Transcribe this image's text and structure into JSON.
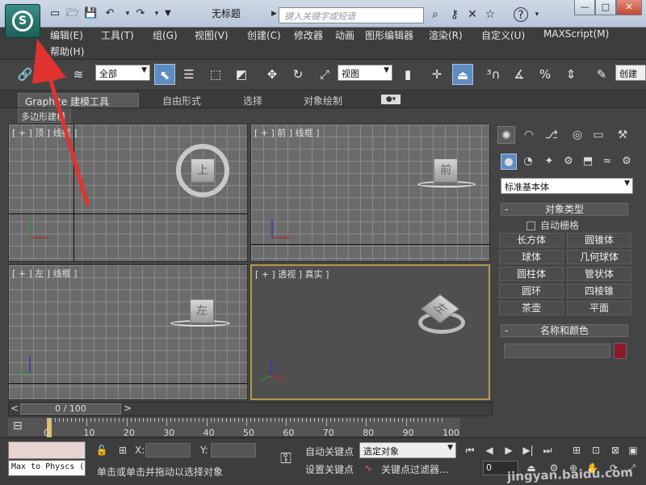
{
  "window": {
    "title": "无标题",
    "search_placeholder": "键入关键字或短语",
    "minimize": "—",
    "maximize": "□",
    "close": "✕"
  },
  "app_button": {
    "label": "S"
  },
  "menu": [
    {
      "label": "编辑(E)"
    },
    {
      "label": "工具(T)"
    },
    {
      "label": "组(G)"
    },
    {
      "label": "视图(V)"
    },
    {
      "label": "创建(C)"
    },
    {
      "label": "修改器"
    },
    {
      "label": "动画"
    },
    {
      "label": "图形编辑器"
    },
    {
      "label": "渲染(R)"
    },
    {
      "label": "自定义(U)"
    },
    {
      "label": "MAXScript(M)"
    },
    {
      "label": "帮助(H)"
    }
  ],
  "toolbar": {
    "selection_filter": "全部",
    "reference_coord": "视图",
    "named_selection": "创建"
  },
  "ribbon": {
    "tabs": [
      {
        "label": "Graphite 建模工具"
      },
      {
        "label": "自由形式"
      },
      {
        "label": "选择"
      },
      {
        "label": "对象绘制"
      }
    ],
    "subpanel": "多边形建模"
  },
  "viewports": {
    "top": {
      "label": "[ + ] 顶 ] 线框 ]",
      "cube": "上"
    },
    "front": {
      "label": "[ + ] 前 ] 线框 ]",
      "cube": "前"
    },
    "left": {
      "label": "[ + ] 左 ] 线框 ]",
      "cube": "左"
    },
    "perspective": {
      "label": "[ + ] 透视 ] 真实 ]",
      "cube": "左"
    }
  },
  "command_panel": {
    "category": "标准基本体",
    "object_type_header": "对象类型",
    "autogrid": "自动栅格",
    "objects": [
      "长方体",
      "圆锥体",
      "球体",
      "几何球体",
      "圆柱体",
      "管状体",
      "圆环",
      "四棱锥",
      "茶壶",
      "平面"
    ],
    "name_color_header": "名称和颜色",
    "object_color": "#8a1a2a"
  },
  "timeline": {
    "frame_display": "0 / 100",
    "prev": "<",
    "next": ">",
    "ticks": [
      "0",
      "10",
      "20",
      "30",
      "40",
      "50",
      "60",
      "70",
      "80",
      "90",
      "100"
    ]
  },
  "status": {
    "script_listener": "Max to Physcs (",
    "prompt": "单击或单击并拖动以选择对象",
    "x_label": "X:",
    "y_label": "Y:",
    "auto_key": "自动关键点",
    "set_key": "设置关键点",
    "key_filter_dropdown": "选定对象",
    "key_filters": "关键点过滤器...",
    "current_frame": "0"
  },
  "watermark": "jingyan.baidu.com"
}
